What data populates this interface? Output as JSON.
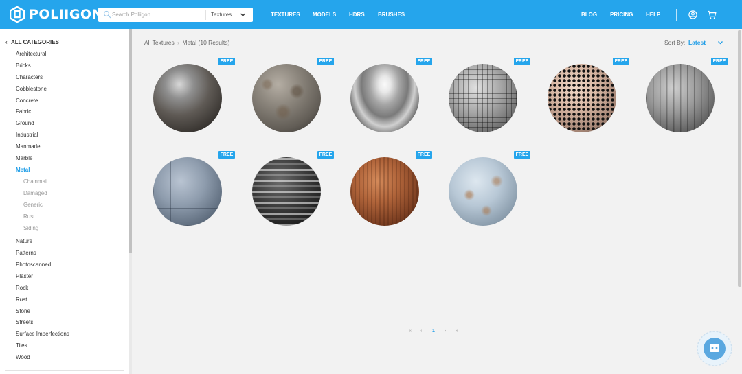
{
  "header": {
    "logo_text": "POLIIGON",
    "search_placeholder": "Search Poliigon...",
    "search_category": "Textures",
    "nav_main": [
      "TEXTURES",
      "MODELS",
      "HDRS",
      "BRUSHES"
    ],
    "nav_right": [
      "BLOG",
      "PRICING",
      "HELP"
    ]
  },
  "sidebar": {
    "all_categories": "ALL CATEGORIES",
    "categories_top": [
      "Architectural",
      "Bricks",
      "Characters",
      "Cobblestone",
      "Concrete",
      "Fabric",
      "Ground",
      "Industrial",
      "Manmade",
      "Marble"
    ],
    "active_category": "Metal",
    "subcategories": [
      "Chainmail",
      "Damaged",
      "Generic",
      "Rust",
      "Siding"
    ],
    "categories_bottom": [
      "Nature",
      "Patterns",
      "Photoscanned",
      "Plaster",
      "Rock",
      "Rust",
      "Stone",
      "Streets",
      "Surface Imperfections",
      "Tiles",
      "Wood"
    ]
  },
  "main": {
    "breadcrumb_root": "All Textures",
    "breadcrumb_sep": "›",
    "breadcrumb_current": "Metal (10 Results)",
    "sort_label": "Sort By:",
    "sort_value": "Latest",
    "free_label": "FREE",
    "textures": [
      {
        "style": "dark-steel"
      },
      {
        "style": "corroded-grey"
      },
      {
        "style": "chrome"
      },
      {
        "style": "chainmail"
      },
      {
        "style": "hex-mesh"
      },
      {
        "style": "siding"
      },
      {
        "style": "panels"
      },
      {
        "style": "scratched-black"
      },
      {
        "style": "rust"
      },
      {
        "style": "painted-rust"
      }
    ],
    "pagination": [
      "«",
      "‹",
      "1",
      "›",
      "»"
    ],
    "current_page": "1"
  },
  "colors": {
    "accent": "#25a5ec",
    "link": "#1e9de7",
    "background": "#f2f2f2"
  }
}
